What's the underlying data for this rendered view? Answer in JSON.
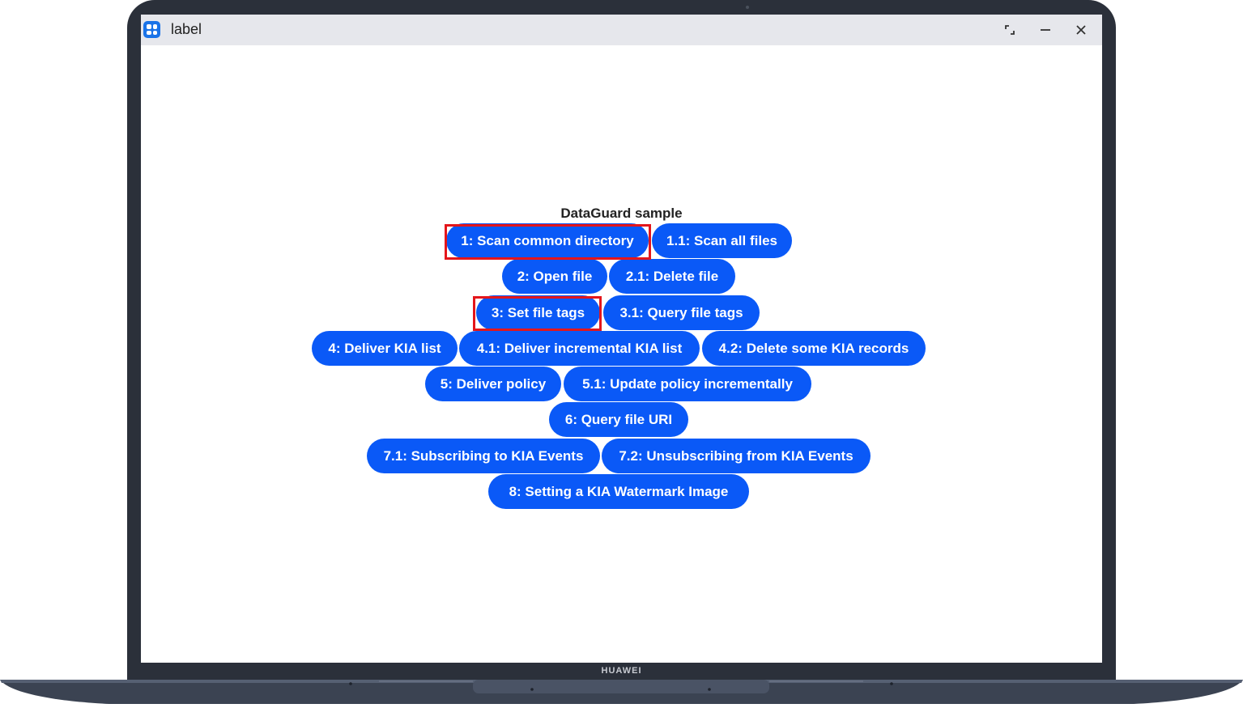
{
  "window": {
    "title": "label",
    "controls": [
      "restore-icon",
      "minimize-icon",
      "close-icon"
    ]
  },
  "page": {
    "heading": "DataGuard sample",
    "buttons": [
      "1: Scan common directory",
      "1.1: Scan all files",
      "2: Open file",
      "2.1: Delete file",
      "3: Set file tags",
      "3.1: Query file tags",
      "4: Deliver KIA list",
      "4.1: Deliver incremental KIA list",
      "4.2: Delete some KIA records",
      "5: Deliver policy",
      "5.1: Update policy incrementally",
      "6: Query file URI",
      "7.1: Subscribing to KIA Events",
      "7.2: Unsubscribing from KIA Events",
      "8: Setting a KIA Watermark Image"
    ],
    "highlighted": [
      "1: Scan common directory",
      "3: Set file tags"
    ]
  },
  "device": {
    "brand": "HUAWEI"
  },
  "colors": {
    "button": "#0a59f7",
    "highlight": "#e4161b",
    "titlebar": "#e6e7ec",
    "bezel": "#2b303a"
  }
}
